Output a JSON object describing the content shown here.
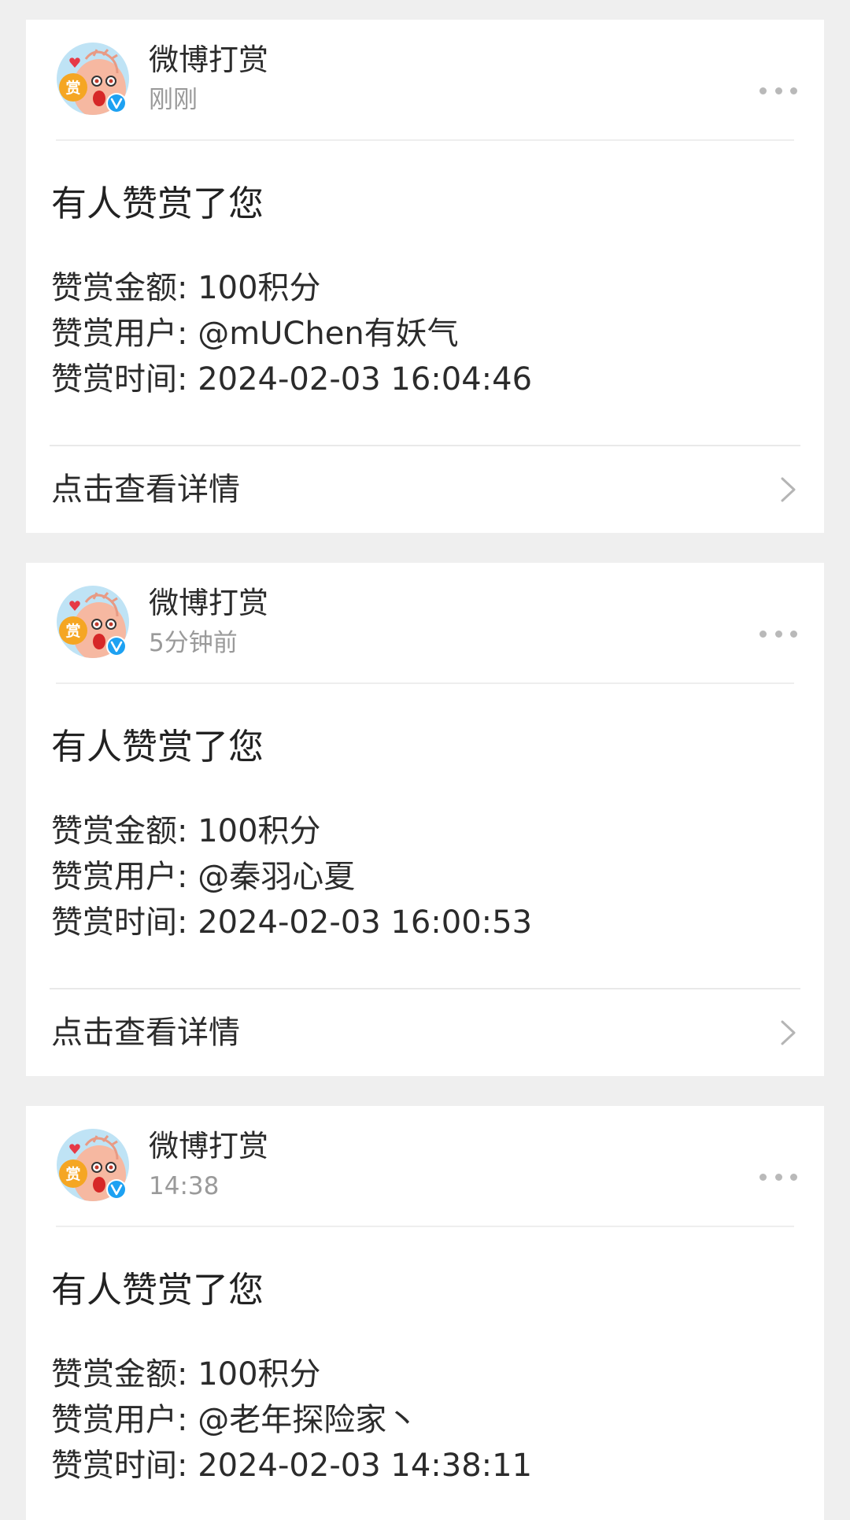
{
  "notifications": [
    {
      "sender": "微博打赏",
      "time": "刚刚",
      "title": "有人赞赏了您",
      "amount_line": "赞赏金额: 100积分",
      "user_line": "赞赏用户: @mUChen有妖气",
      "time_line": "赞赏时间: 2024-02-03 16:04:46",
      "footer_label": "点击查看详情"
    },
    {
      "sender": "微博打赏",
      "time": "5分钟前",
      "title": "有人赞赏了您",
      "amount_line": "赞赏金额: 100积分",
      "user_line": "赞赏用户: @秦羽心夏",
      "time_line": "赞赏时间: 2024-02-03 16:00:53",
      "footer_label": "点击查看详情"
    },
    {
      "sender": "微博打赏",
      "time": "14:38",
      "title": "有人赞赏了您",
      "amount_line": "赞赏金额: 100积分",
      "user_line": "赞赏用户: @老年探险家丶",
      "time_line": "赞赏时间: 2024-02-03 14:38:11"
    }
  ],
  "avatar": {
    "badge_text": "赏",
    "icon": "weibo-reward-mascot-icon",
    "verified_icon": "verified-v-icon"
  },
  "colors": {
    "page_bg": "#efefef",
    "card_bg": "#ffffff",
    "secondary_text": "#9a9a9a",
    "verified_blue": "#1da1f2",
    "badge_orange": "#f5a623"
  }
}
